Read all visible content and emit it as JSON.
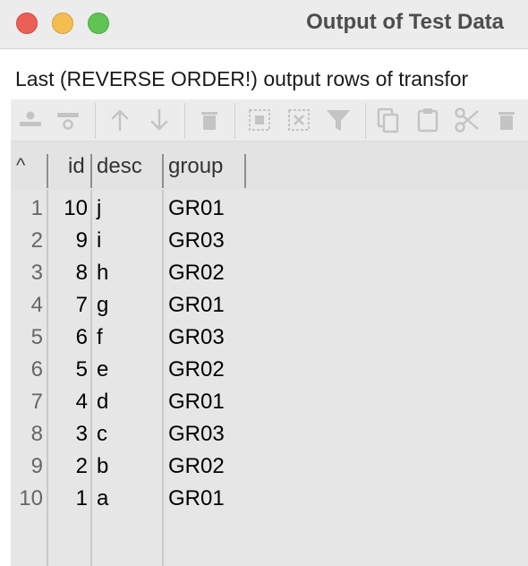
{
  "window": {
    "title": "Output of Test Data"
  },
  "description": "Last (REVERSE ORDER!) output rows of transfor",
  "toolbar": {
    "buttons": [
      {
        "icon": "insert-row-before-icon"
      },
      {
        "icon": "insert-row-after-icon"
      },
      {
        "icon": "move-up-icon"
      },
      {
        "icon": "move-down-icon"
      },
      {
        "icon": "delete-icon"
      },
      {
        "icon": "select-all-icon"
      },
      {
        "icon": "clear-selection-icon"
      },
      {
        "icon": "filter-icon"
      },
      {
        "icon": "copy-icon"
      },
      {
        "icon": "paste-icon"
      },
      {
        "icon": "cut-icon"
      },
      {
        "icon": "delete-selected-icon"
      }
    ]
  },
  "grid": {
    "sort_glyph": "^",
    "columns": [
      "id",
      "desc",
      "group"
    ],
    "rows": [
      {
        "num": "1",
        "id": "10",
        "desc": "j",
        "group": "GR01"
      },
      {
        "num": "2",
        "id": "9",
        "desc": "i",
        "group": "GR03"
      },
      {
        "num": "3",
        "id": "8",
        "desc": "h",
        "group": "GR02"
      },
      {
        "num": "4",
        "id": "7",
        "desc": "g",
        "group": "GR01"
      },
      {
        "num": "5",
        "id": "6",
        "desc": "f",
        "group": "GR03"
      },
      {
        "num": "6",
        "id": "5",
        "desc": "e",
        "group": "GR02"
      },
      {
        "num": "7",
        "id": "4",
        "desc": "d",
        "group": "GR01"
      },
      {
        "num": "8",
        "id": "3",
        "desc": "c",
        "group": "GR03"
      },
      {
        "num": "9",
        "id": "2",
        "desc": "b",
        "group": "GR02"
      },
      {
        "num": "10",
        "id": "1",
        "desc": "a",
        "group": "GR01"
      }
    ]
  }
}
